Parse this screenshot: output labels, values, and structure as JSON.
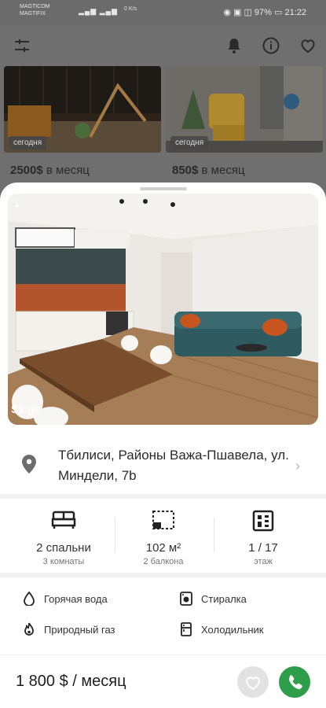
{
  "status_bar": {
    "operator_1": "MAGTICOM",
    "operator_2": "MAGTIFIX",
    "speed": "0 K/s",
    "battery": "97%",
    "time": "21:22"
  },
  "listing_cards": [
    {
      "tag": "сегодня",
      "price": "2500$",
      "period": "в месяц"
    },
    {
      "tag": "сегодня",
      "price": "850$",
      "period": "в месяц"
    }
  ],
  "detail": {
    "photo_counter": "1",
    "watermark": "Ss.ge",
    "address": "Тбилиси, Районы Важа-Пшавела, ул. Миндели, 7b",
    "stats": [
      {
        "value": "2 спальни",
        "sub": "3 комнаты",
        "icon": "bed-icon"
      },
      {
        "value": "102 м²",
        "sub": "2 балкона",
        "icon": "area-icon"
      },
      {
        "value": "1 / 17",
        "sub": "этаж",
        "icon": "floor-icon"
      }
    ],
    "amenities": [
      {
        "label": "Горячая вода",
        "icon": "water-drop-icon"
      },
      {
        "label": "Стиралка",
        "icon": "washing-machine-icon"
      },
      {
        "label": "Природный газ",
        "icon": "gas-flame-icon"
      },
      {
        "label": "Холодильник",
        "icon": "fridge-icon"
      }
    ],
    "price_label": "1 800 $ / месяц"
  },
  "colors": {
    "call_button": "#2e9e4a",
    "sheet_background": "#ffffff",
    "overlay": "#6f6f6f"
  }
}
